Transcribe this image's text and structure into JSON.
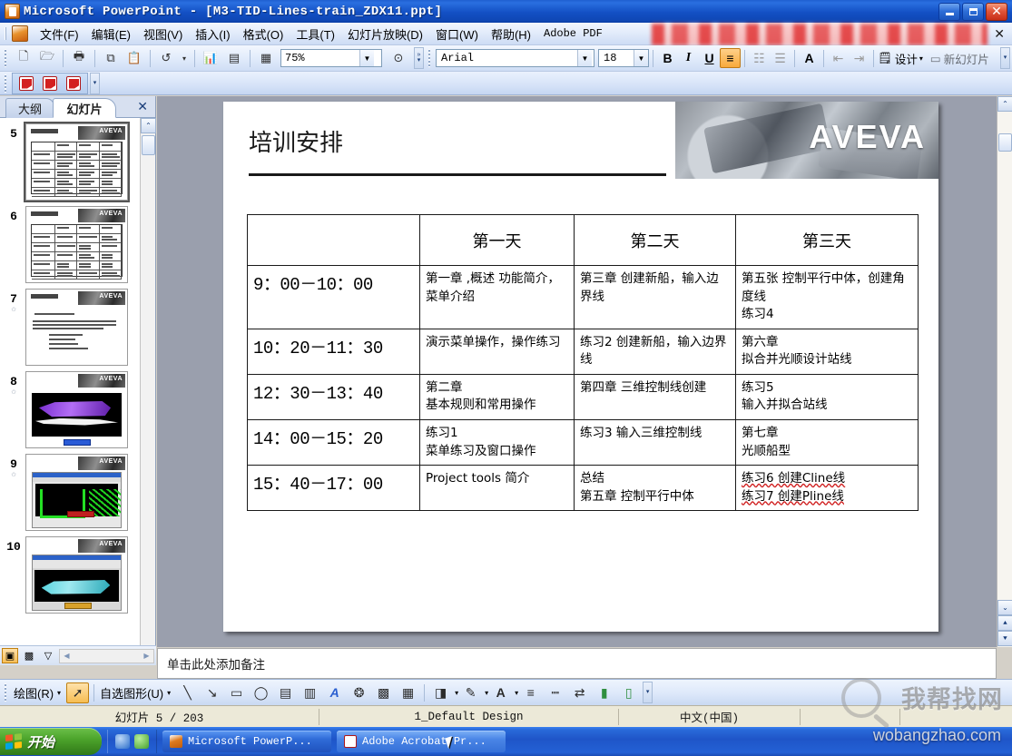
{
  "window": {
    "title": "Microsoft PowerPoint - [M3-TID-Lines-train_ZDX11.ppt]",
    "app_icon": "powerpoint-icon",
    "minimize_label": "",
    "maximize_label": "",
    "close_label": "✕"
  },
  "menubar": {
    "items": [
      {
        "label": "文件(F)",
        "name": "menu-file"
      },
      {
        "label": "编辑(E)",
        "name": "menu-edit"
      },
      {
        "label": "视图(V)",
        "name": "menu-view"
      },
      {
        "label": "插入(I)",
        "name": "menu-insert"
      },
      {
        "label": "格式(O)",
        "name": "menu-format"
      },
      {
        "label": "工具(T)",
        "name": "menu-tools"
      },
      {
        "label": "幻灯片放映(D)",
        "name": "menu-slideshow"
      },
      {
        "label": "窗口(W)",
        "name": "menu-window"
      },
      {
        "label": "帮助(H)",
        "name": "menu-help"
      },
      {
        "label": "Adobe PDF",
        "name": "menu-adobe-pdf"
      }
    ],
    "close_document_label": "✕"
  },
  "toolbar": {
    "buttons": [
      {
        "name": "new-icon",
        "glyph": "🗋"
      },
      {
        "name": "open-icon",
        "glyph": "🗁"
      },
      {
        "name": "print-icon",
        "glyph": "🖨"
      },
      {
        "name": "copy-icon",
        "glyph": "⧉"
      },
      {
        "name": "paste-icon",
        "glyph": "📋"
      },
      {
        "name": "undo-icon",
        "glyph": "↩"
      },
      {
        "name": "chart-icon",
        "glyph": "📊"
      },
      {
        "name": "table-icon",
        "glyph": "▤"
      },
      {
        "name": "grid-icon",
        "glyph": "▦"
      }
    ],
    "zoom_value": "75%",
    "help_icon": "help-icon",
    "font_name": "Arial",
    "font_size": "18",
    "bold_label": "B",
    "italic_label": "I",
    "underline_label": "U",
    "align_left_label": "≡",
    "bullets_label": "☰",
    "numbering_label": "☷",
    "font_grow_label": "A",
    "demote_label": "⇥",
    "promote_label": "⇤",
    "design_label": "设计",
    "new_slide_label": "新幻灯片",
    "overflow_label": "»"
  },
  "acrobat_toolbar": {
    "buttons": [
      {
        "name": "convert-to-pdf-icon"
      },
      {
        "name": "convert-and-email-pdf-icon"
      },
      {
        "name": "convert-and-review-pdf-icon"
      }
    ],
    "overflow_label": "▾"
  },
  "slide_pane": {
    "tabs": [
      {
        "label": "大纲",
        "name": "tab-outline",
        "active": false
      },
      {
        "label": "幻灯片",
        "name": "tab-slides",
        "active": true
      }
    ],
    "close_label": "✕",
    "thumbnails": [
      {
        "number": "5",
        "type": "table",
        "selected": true,
        "starred": false
      },
      {
        "number": "6",
        "type": "table",
        "selected": false,
        "starred": false
      },
      {
        "number": "7",
        "type": "bullets",
        "selected": false,
        "starred": true
      },
      {
        "number": "8",
        "type": "image-purple",
        "selected": false,
        "starred": true
      },
      {
        "number": "9",
        "type": "image-green",
        "selected": false,
        "starred": true
      },
      {
        "number": "10",
        "type": "image-cyan",
        "selected": false,
        "starred": false
      }
    ],
    "scroll_up_label": "⌃",
    "scroll_down_label": "⌄",
    "view_buttons": [
      {
        "name": "normal-view-button",
        "glyph": "▣",
        "active": true
      },
      {
        "name": "slide-sorter-button",
        "glyph": "▩",
        "active": false
      },
      {
        "name": "slideshow-button",
        "glyph": "▽",
        "active": false
      }
    ]
  },
  "slide": {
    "title": "培训安排",
    "brand": "AVEVA",
    "table": {
      "headers": [
        "",
        "第一天",
        "第二天",
        "第三天"
      ],
      "rows": [
        {
          "time": "9：00－10：00",
          "day1": "第一章 ,概述 功能简介，菜单介绍",
          "day2": "第三章 创建新船，输入边界线",
          "day3": "第五张 控制平行中体，创建角度线\n练习4"
        },
        {
          "time": "10：20－11：30",
          "day1": "演示菜单操作，操作练习",
          "day2": "练习2 创建新船，输入边界线",
          "day3": "第六章\n拟合并光顺设计站线"
        },
        {
          "time": "12：30－13：40",
          "day1": "第二章\n基本规则和常用操作",
          "day2": "第四章 三维控制线创建",
          "day3": "练习5\n输入并拟合站线"
        },
        {
          "time": "14：00－15：20",
          "day1": "练习1\n菜单练习及窗口操作",
          "day2": "练习3 输入三维控制线",
          "day3": "第七章\n光顺船型"
        },
        {
          "time": "15：40－17：00",
          "day1": "Project tools 简介",
          "day2": "总结\n第五章 控制平行中体",
          "day3": "练习6 创建Cline线\n练习7 创建Pline线"
        }
      ]
    }
  },
  "notes": {
    "placeholder": "单击此处添加备注"
  },
  "drawing_toolbar": {
    "draw_label": "绘图(R)",
    "select_icon": "arrow-select-icon",
    "autoshapes_label": "自选图形(U)",
    "tools": [
      {
        "name": "line-icon",
        "glyph": "╲"
      },
      {
        "name": "arrow-icon",
        "glyph": "↘"
      },
      {
        "name": "rectangle-icon",
        "glyph": "▭"
      },
      {
        "name": "ellipse-icon",
        "glyph": "◯"
      },
      {
        "name": "textbox-icon",
        "glyph": "▣"
      },
      {
        "name": "vertical-textbox-icon",
        "glyph": "▥"
      },
      {
        "name": "wordart-icon",
        "glyph": "A"
      },
      {
        "name": "diagram-icon",
        "glyph": "❂"
      },
      {
        "name": "clipart-icon",
        "glyph": "🖼"
      },
      {
        "name": "picture-icon",
        "glyph": "🖻"
      },
      {
        "name": "fill-color-icon",
        "glyph": "🪣"
      },
      {
        "name": "line-color-icon",
        "glyph": "🖌"
      },
      {
        "name": "font-color-icon",
        "glyph": "A"
      },
      {
        "name": "line-style-icon",
        "glyph": "≡"
      },
      {
        "name": "dash-style-icon",
        "glyph": "⋯"
      },
      {
        "name": "arrow-style-icon",
        "glyph": "⇄"
      },
      {
        "name": "shadow-style-icon",
        "glyph": "▮"
      },
      {
        "name": "3d-style-icon",
        "glyph": "▯"
      }
    ],
    "overflow_label": "▾"
  },
  "statusbar": {
    "slide_label": "幻灯片 5 / 203",
    "design_label": "1_Default Design",
    "language_label": "中文(中国)",
    "extra": ""
  },
  "taskbar": {
    "start_label": "开始",
    "quick_launch": [
      {
        "name": "quicklaunch-ie-icon",
        "color": "#2b6ecb"
      },
      {
        "name": "quicklaunch-msn-icon",
        "color": "#46a02e"
      }
    ],
    "items": [
      {
        "label": "Microsoft PowerP...",
        "name": "taskbar-item-powerpoint",
        "active": false,
        "icon_color": "#e07b1e"
      },
      {
        "label": "Adobe Acrobat Pr...",
        "name": "taskbar-item-acrobat",
        "active": true,
        "icon_color": "#d32020"
      }
    ]
  },
  "watermark": {
    "chinese": "我帮找网",
    "english": "wobangzhao.com"
  },
  "colors": {
    "titlebar_blue": "#1350c4",
    "accent_orange": "#f8a93b",
    "status_bg": "#ece9d8",
    "slide_bg": "#9a9fad"
  }
}
